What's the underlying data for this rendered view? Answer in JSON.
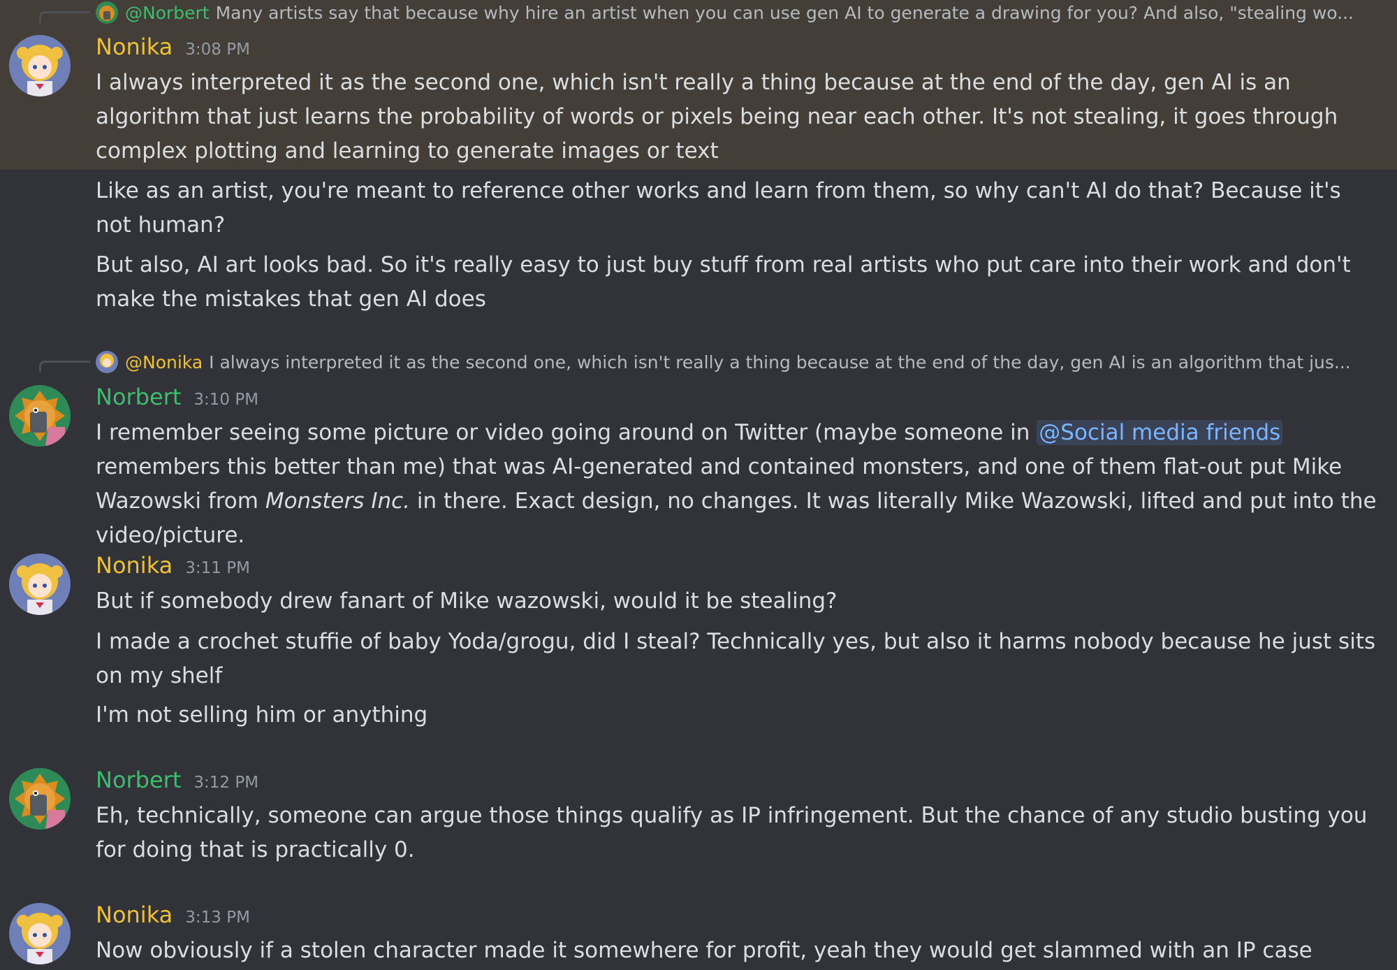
{
  "messages": {
    "m1": {
      "reply": {
        "name": "@Norbert",
        "text": "Many artists say that because why hire an artist when you can use gen AI to generate a drawing for you? And also, \"stealing wo..."
      },
      "username": "Nonika",
      "time": "3:08 PM",
      "lines": [
        "I always interpreted it as the second one, which isn't really a thing because at the end of the day, gen AI is an algorithm that just learns the probability of words or pixels being near each other. It's not stealing, it goes through complex plotting and learning to generate images or text",
        "Like as an artist, you're meant to reference other works and learn from them, so why can't AI do that? Because it's not human?",
        "But also, AI art looks bad. So it's really easy to just buy stuff from real artists who put care into their work and don't make the mistakes that gen AI does"
      ]
    },
    "m2": {
      "reply": {
        "name": "@Nonika",
        "text": "I always interpreted it as the second one, which isn't really a thing because at the end of the day, gen AI is an algorithm that jus..."
      },
      "username": "Norbert",
      "time": "3:10 PM",
      "text_a": "I remember seeing some picture or video going around on Twitter (maybe someone in ",
      "mention": "@Social media friends",
      "text_b": " remembers this better than me) that was AI-generated and contained monsters, and one of them flat-out put Mike Wazowski from ",
      "italic": "Monsters Inc.",
      "text_c": " in there. Exact design, no changes. It was literally Mike Wazowski, lifted and put into the video/picture."
    },
    "m3": {
      "username": "Nonika",
      "time": "3:11 PM",
      "lines": [
        "But if somebody drew fanart of Mike wazowski, would it be stealing?",
        "I made a crochet stuffie of baby Yoda/grogu, did I steal? Technically yes, but also it harms nobody because he just sits on my shelf",
        "I'm not selling him or anything"
      ]
    },
    "m4": {
      "username": "Norbert",
      "time": "3:12 PM",
      "lines": [
        "Eh, technically, someone can argue those things qualify as IP infringement. But the chance of any studio busting you for doing that is practically 0."
      ]
    },
    "m5": {
      "username": "Nonika",
      "time": "3:13 PM",
      "lines": [
        "Now obviously if a stolen character made it somewhere for profit, yeah they would get slammed with an IP case"
      ]
    }
  },
  "colors": {
    "nonika": "#f0c22f",
    "norbert": "#3fbd6f",
    "mention_bg": "#3a4256",
    "mention_text": "#7ab6ff",
    "highlight": "#433f38",
    "background": "#313338"
  }
}
